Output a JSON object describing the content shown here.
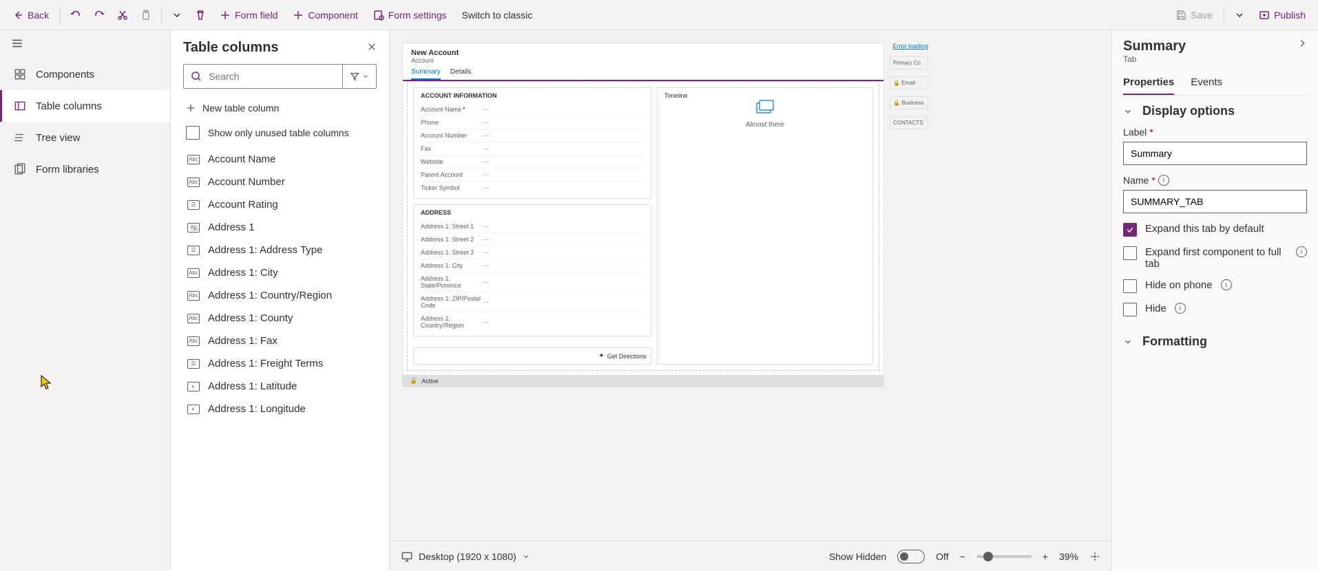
{
  "toolbar": {
    "back": "Back",
    "form_field": "Form field",
    "component": "Component",
    "form_settings": "Form settings",
    "switch_classic": "Switch to classic",
    "save": "Save",
    "publish": "Publish"
  },
  "left_nav": {
    "components": "Components",
    "table_columns": "Table columns",
    "tree_view": "Tree view",
    "form_libraries": "Form libraries"
  },
  "columns_panel": {
    "title": "Table columns",
    "search_placeholder": "Search",
    "new_col": "New table column",
    "show_only": "Show only unused table columns",
    "items": [
      {
        "label": "Account Name",
        "icon": "Abc"
      },
      {
        "label": "Account Number",
        "icon": "Abc"
      },
      {
        "label": "Account Rating",
        "icon": "☰"
      },
      {
        "label": "Address 1",
        "icon": "A͟b͟"
      },
      {
        "label": "Address 1: Address Type",
        "icon": "☰"
      },
      {
        "label": "Address 1: City",
        "icon": "Abc"
      },
      {
        "label": "Address 1: Country/Region",
        "icon": "Abc"
      },
      {
        "label": "Address 1: County",
        "icon": "Abc"
      },
      {
        "label": "Address 1: Fax",
        "icon": "Abc"
      },
      {
        "label": "Address 1: Freight Terms",
        "icon": "☰"
      },
      {
        "label": "Address 1: Latitude",
        "icon": "◐"
      },
      {
        "label": "Address 1: Longitude",
        "icon": "◐"
      }
    ]
  },
  "canvas": {
    "form_title": "New Account",
    "form_subtitle": "Account",
    "tabs": [
      "Summary",
      "Details"
    ],
    "active_tab": 0,
    "section_account": {
      "title": "ACCOUNT INFORMATION",
      "fields": [
        {
          "label": "Account Name",
          "required": true,
          "value": "---"
        },
        {
          "label": "Phone",
          "value": "---"
        },
        {
          "label": "Account Number",
          "value": "---"
        },
        {
          "label": "Fax",
          "value": "---"
        },
        {
          "label": "Website",
          "value": "---"
        },
        {
          "label": "Parent Account",
          "value": "---"
        },
        {
          "label": "Ticker Symbol",
          "value": "---"
        }
      ]
    },
    "section_address": {
      "title": "ADDRESS",
      "fields": [
        {
          "label": "Address 1: Street 1",
          "value": "---"
        },
        {
          "label": "Address 1: Street 2",
          "value": "---"
        },
        {
          "label": "Address 1: Street 3",
          "value": "---"
        },
        {
          "label": "Address 1: City",
          "value": "---"
        },
        {
          "label": "Address 1: State/Province",
          "value": "---"
        },
        {
          "label": "Address 1: ZIP/Postal Code",
          "value": "---"
        },
        {
          "label": "Address 1: Country/Region",
          "value": "---"
        }
      ]
    },
    "timeline": {
      "title": "Timeline",
      "almost": "Almost there",
      "error": "Error loading"
    },
    "side": {
      "primary": "Primary Co",
      "email": "Email",
      "business": "Business",
      "contacts": "CONTACTS"
    },
    "get_directions": "Get Directions",
    "status": "Active",
    "footer": {
      "device": "Desktop (1920 x 1080)",
      "show_hidden": "Show Hidden",
      "toggle_state": "Off",
      "zoom_pct": "39%"
    }
  },
  "props": {
    "title": "Summary",
    "subtitle": "Tab",
    "tabs": [
      "Properties",
      "Events"
    ],
    "display_options": "Display options",
    "label_label": "Label",
    "label_value": "Summary",
    "name_label": "Name",
    "name_value": "SUMMARY_TAB",
    "expand_default": "Expand this tab by default",
    "expand_first": "Expand first component to full tab",
    "hide_phone": "Hide on phone",
    "hide": "Hide",
    "formatting": "Formatting"
  }
}
